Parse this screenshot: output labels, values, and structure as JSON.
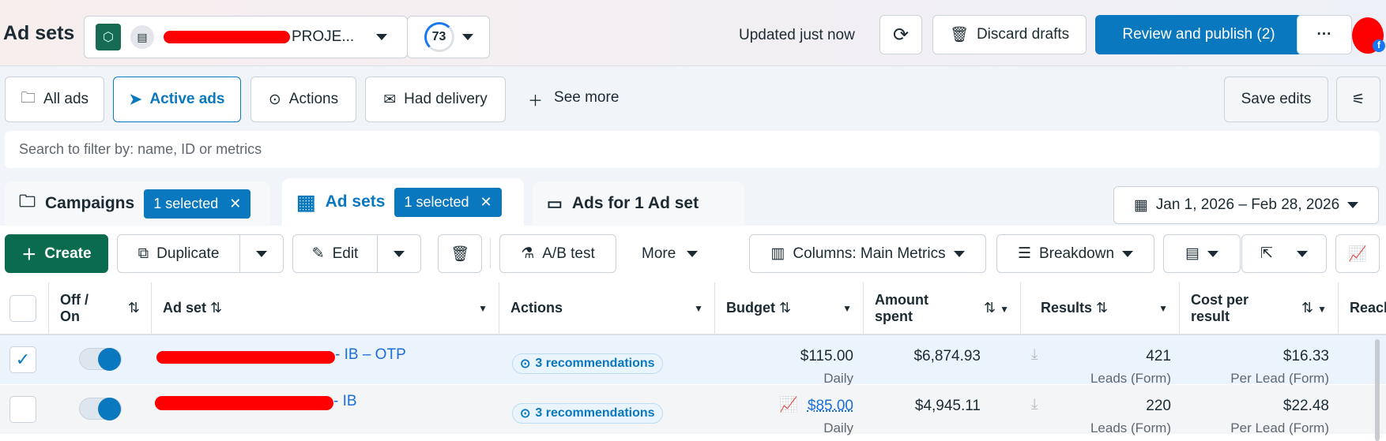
{
  "header": {
    "title": "Ad sets",
    "account_suffix": "PROJE...",
    "score": "73",
    "updated": "Updated just now",
    "discard": "Discard drafts",
    "publish": "Review and publish (2)",
    "more": "···"
  },
  "filters": {
    "all_ads": "All ads",
    "active_ads": "Active ads",
    "actions": "Actions",
    "had_delivery": "Had delivery",
    "see_more": "See more",
    "save_edits": "Save edits"
  },
  "search": {
    "placeholder": "Search to filter by: name, ID or metrics"
  },
  "tabs": [
    {
      "label": "Campaigns",
      "badge": "1 selected"
    },
    {
      "label": "Ad sets",
      "badge": "1 selected"
    },
    {
      "label": "Ads for 1 Ad set"
    }
  ],
  "date_range": "Jan 1, 2026 – Feb 28, 2026",
  "toolbar": {
    "create": "Create",
    "duplicate": "Duplicate",
    "edit": "Edit",
    "ab_test": "A/B test",
    "more": "More",
    "columns": "Columns: Main Metrics",
    "breakdown": "Breakdown"
  },
  "columns": {
    "offon1": "Off /",
    "offon2": "On",
    "adset": "Ad set",
    "actions": "Actions",
    "budget": "Budget",
    "amount1": "Amount",
    "amount2": "spent",
    "results": "Results",
    "cost1": "Cost per",
    "cost2": "result",
    "reach": "Reach"
  },
  "rows": [
    {
      "name_suffix": "- IB – OTP",
      "recommendations": "3 recommendations",
      "budget": "$115.00",
      "budget_type": "Daily",
      "spent": "$6,874.93",
      "results": "421",
      "results_type": "Leads (Form)",
      "cost": "$16.33",
      "cost_type": "Per Lead (Form)",
      "selected": true
    },
    {
      "name_suffix": "- IB",
      "recommendations": "3 recommendations",
      "budget": "$85.00",
      "budget_type": "Daily",
      "spent": "$4,945.11",
      "results": "220",
      "results_type": "Leads (Form)",
      "cost": "$22.48",
      "cost_type": "Per Lead (Form)",
      "selected": false
    }
  ],
  "colors": {
    "accent": "#0a78be",
    "create": "#0a6b4f"
  }
}
